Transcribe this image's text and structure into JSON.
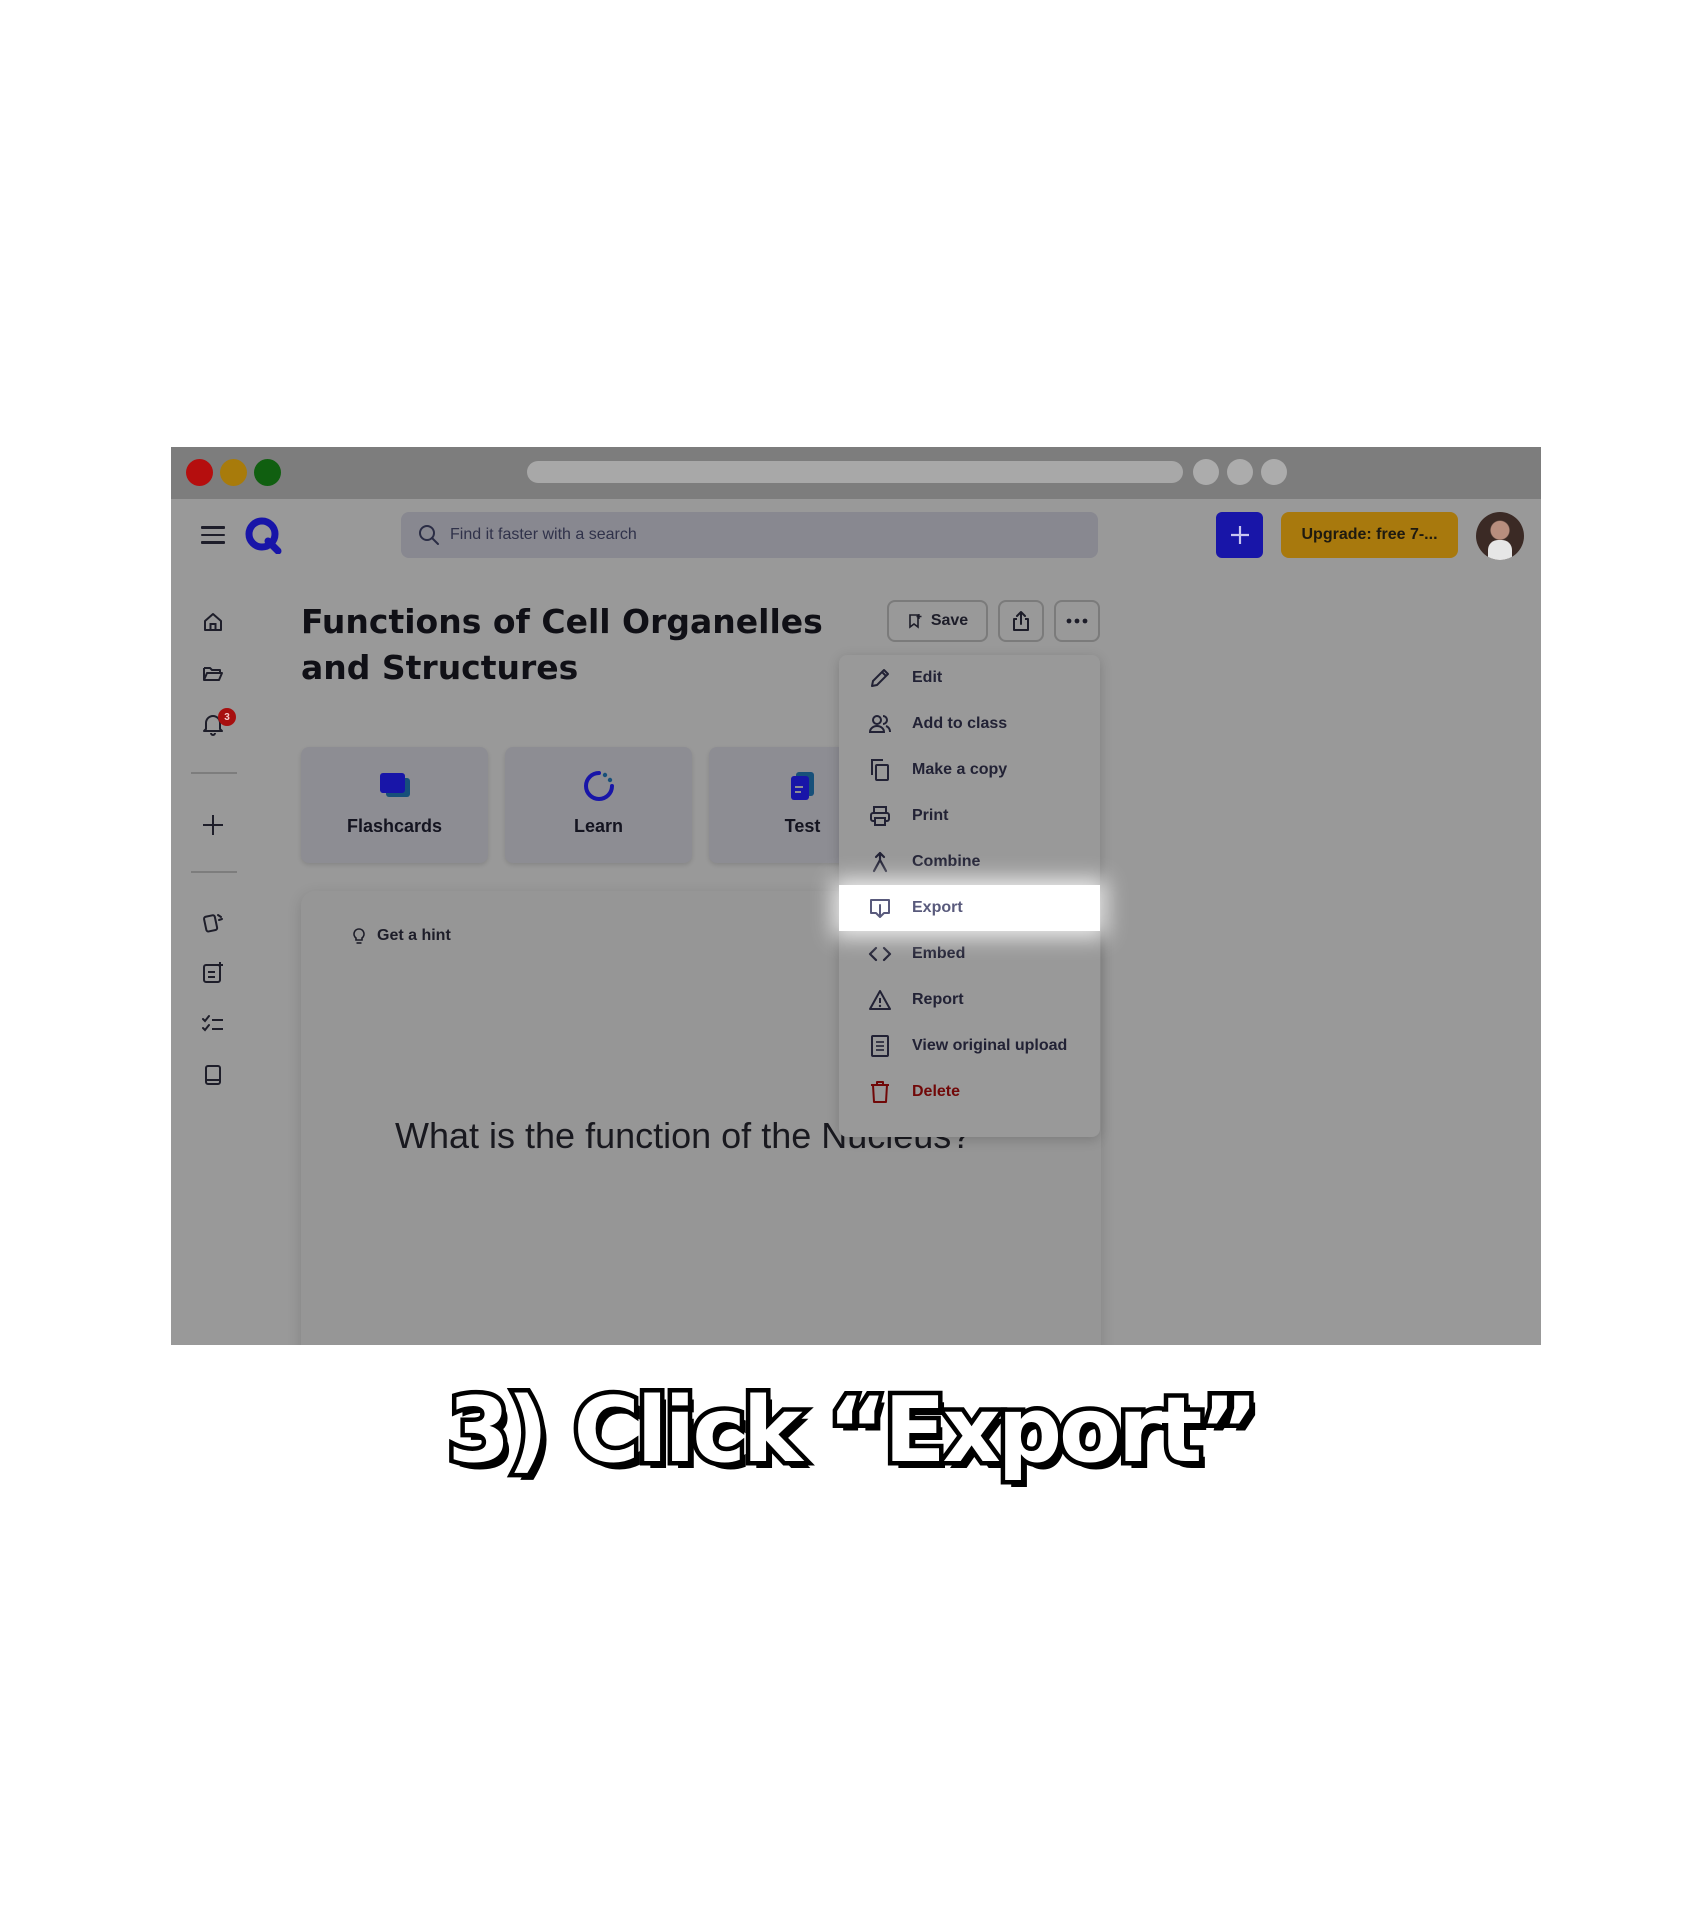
{
  "window": {
    "search_placeholder": "Find it faster with a search",
    "upgrade_label": "Upgrade: free 7-...",
    "notification_count": "3"
  },
  "study_set": {
    "title": "Functions of Cell Organelles and Structures",
    "save_label": "Save",
    "modes": [
      {
        "label": "Flashcards",
        "icon": "flashcards-icon"
      },
      {
        "label": "Learn",
        "icon": "learn-icon"
      },
      {
        "label": "Test",
        "icon": "test-icon"
      }
    ],
    "hint_label": "Get a hint",
    "question": "What is the function of the Nucleus?"
  },
  "menu": {
    "items": [
      {
        "label": "Edit",
        "icon": "pencil-icon"
      },
      {
        "label": "Add to class",
        "icon": "people-icon"
      },
      {
        "label": "Make a copy",
        "icon": "copy-icon"
      },
      {
        "label": "Print",
        "icon": "printer-icon"
      },
      {
        "label": "Combine",
        "icon": "merge-icon"
      },
      {
        "label": "Export",
        "icon": "export-icon",
        "highlighted": true
      },
      {
        "label": "Embed",
        "icon": "code-icon"
      },
      {
        "label": "Report",
        "icon": "warning-icon"
      },
      {
        "label": "View original upload",
        "icon": "document-icon"
      },
      {
        "label": "Delete",
        "icon": "trash-icon",
        "color": "#710808"
      }
    ]
  },
  "caption": "3) Click “Export”",
  "colors": {
    "brand_blue": "#1815a8",
    "upgrade_gold": "#a8790d",
    "highlight": "#ffffff"
  }
}
